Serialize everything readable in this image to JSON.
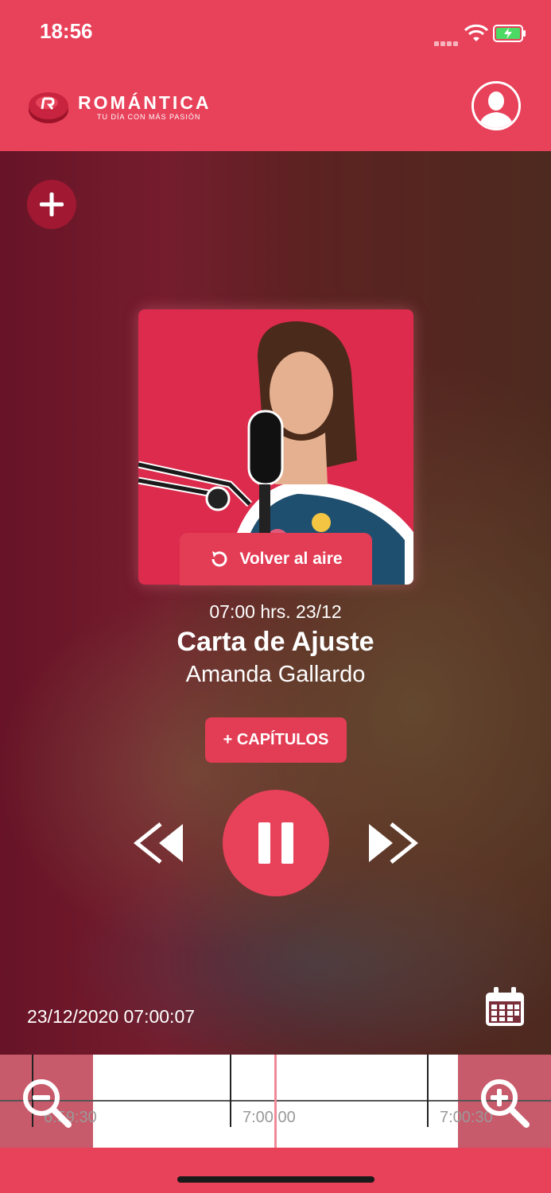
{
  "status_bar": {
    "time": "18:56"
  },
  "header": {
    "brand": "ROMÁNTICA",
    "tagline": "TU DÍA CON MÁS PASIÓN"
  },
  "player": {
    "back_to_live": "Volver al aire",
    "schedule": "07:00 hrs. 23/12",
    "title": "Carta de Ajuste",
    "host": "Amanda Gallardo",
    "chapters_button": "+ CAPÍTULOS",
    "state": "playing"
  },
  "timeline": {
    "current_datetime": "23/12/2020 07:00:07",
    "labels": [
      "6:59:30",
      "7:00:00",
      "7:00:30"
    ]
  },
  "colors": {
    "brand": "#e8415a",
    "add_button": "#a01832"
  }
}
